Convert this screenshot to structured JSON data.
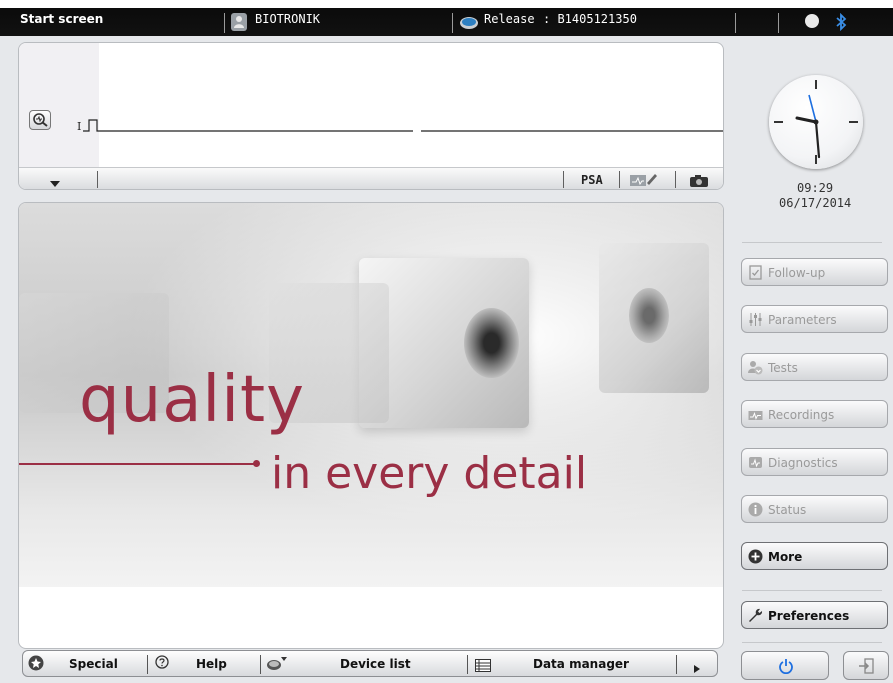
{
  "top_bar": {
    "screen_title": "Start screen",
    "user": "BIOTRONIK",
    "release_label": "Release",
    "release_value": ": B1405121350"
  },
  "ecg_panel": {
    "channel_label": "I",
    "psa_label": "PSA"
  },
  "banner": {
    "headline": "quality",
    "tagline": "in every detail"
  },
  "bottom_bar": {
    "special_label": "Special",
    "help_label": "Help",
    "device_list_label": "Device list",
    "data_manager_label": "Data manager"
  },
  "clock": {
    "time": "09:29",
    "date": "06/17/2014"
  },
  "sidebar": {
    "items": [
      {
        "label": "Follow-up",
        "icon": "follow-up-icon"
      },
      {
        "label": "Parameters",
        "icon": "parameters-icon"
      },
      {
        "label": "Tests",
        "icon": "tests-icon"
      },
      {
        "label": "Recordings",
        "icon": "recordings-icon"
      },
      {
        "label": "Diagnostics",
        "icon": "diagnostics-icon"
      },
      {
        "label": "Status",
        "icon": "status-icon"
      },
      {
        "label": "More",
        "icon": "plus-circle-icon"
      }
    ],
    "preferences_label": "Preferences"
  },
  "colors": {
    "brand_red": "#9b2f45",
    "clock_second_hand": "#1e6fe0",
    "top_bar_bg": "#111111"
  }
}
